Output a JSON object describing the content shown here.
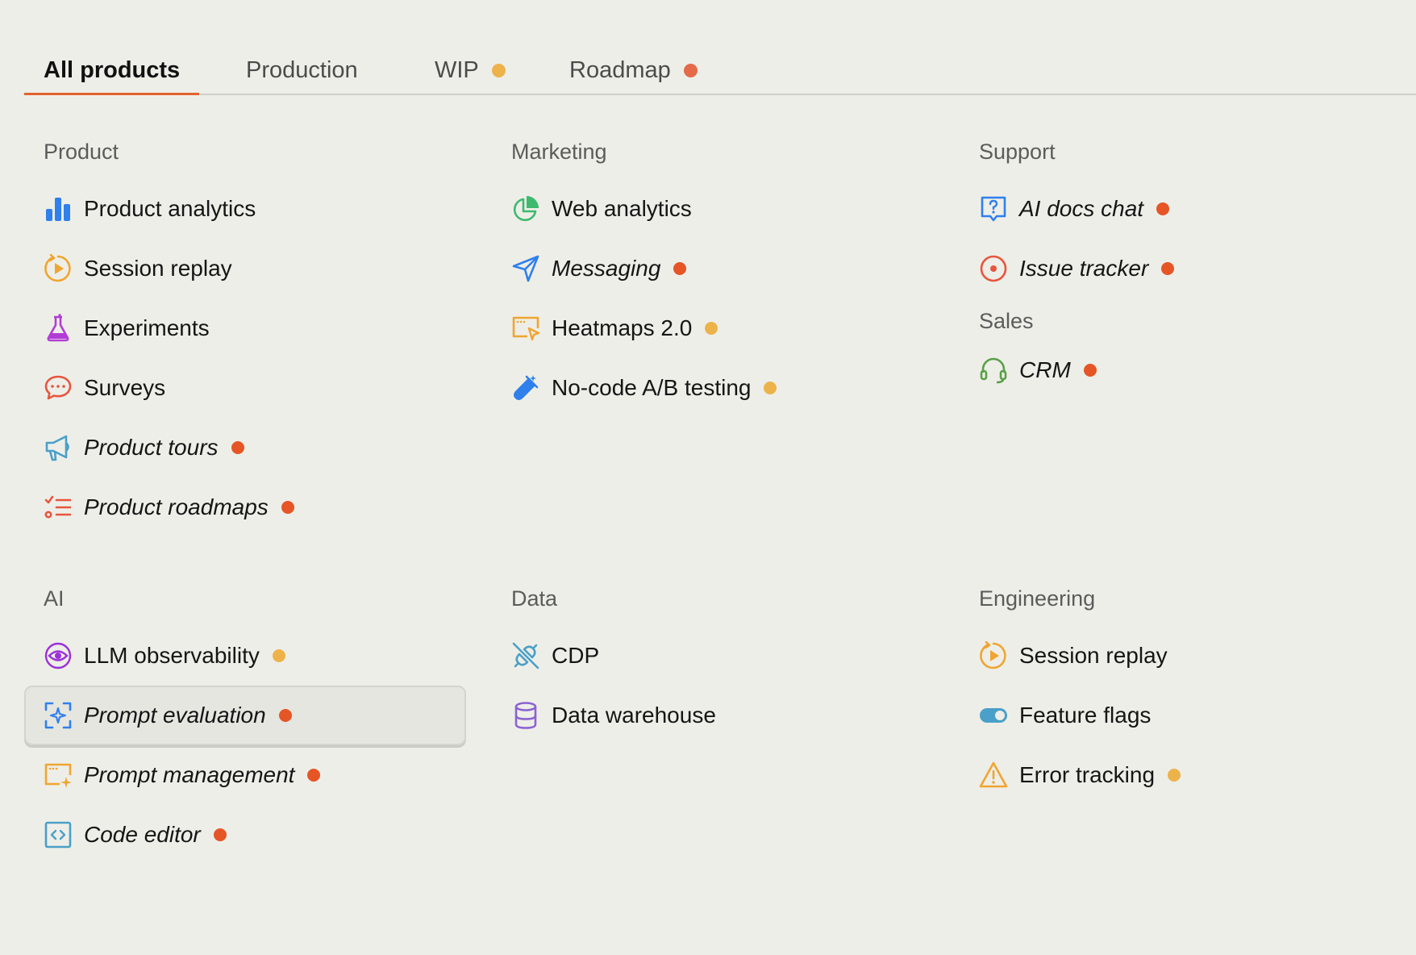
{
  "colors": {
    "background": "#EEEEE8",
    "accent_underline": "#E2622F",
    "roadmap_dot": "#E65525",
    "wip_dot": "#EDB34A"
  },
  "tabs": [
    {
      "label": "All products",
      "active": true
    },
    {
      "label": "Production"
    },
    {
      "label": "WIP",
      "dot": "wip"
    },
    {
      "label": "Roadmap",
      "dot": "roadmap"
    }
  ],
  "sections": [
    {
      "title": "Product",
      "items": [
        {
          "label": "Product analytics",
          "icon": "bar-chart-icon"
        },
        {
          "label": "Session replay",
          "icon": "replay-icon"
        },
        {
          "label": "Experiments",
          "icon": "flask-icon"
        },
        {
          "label": "Surveys",
          "icon": "chat-bubble-icon"
        },
        {
          "label": "Product tours",
          "icon": "megaphone-icon",
          "status": "roadmap",
          "italic": true
        },
        {
          "label": "Product roadmaps",
          "icon": "checklist-icon",
          "status": "roadmap",
          "italic": true
        }
      ]
    },
    {
      "title": "Marketing",
      "items": [
        {
          "label": "Web analytics",
          "icon": "pie-chart-icon"
        },
        {
          "label": "Messaging",
          "icon": "send-icon",
          "status": "roadmap",
          "italic": true
        },
        {
          "label": "Heatmaps 2.0",
          "icon": "heatmap-icon",
          "status": "wip"
        },
        {
          "label": "No-code A/B testing",
          "icon": "test-tube-icon",
          "status": "wip"
        }
      ]
    },
    {
      "title": "Support",
      "items": [
        {
          "label": "AI docs chat",
          "icon": "question-chat-icon",
          "status": "roadmap",
          "italic": true
        },
        {
          "label": "Issue tracker",
          "icon": "target-icon",
          "status": "roadmap",
          "italic": true
        }
      ]
    },
    {
      "title": "Sales",
      "items": [
        {
          "label": "CRM",
          "icon": "headset-icon",
          "status": "roadmap",
          "italic": true
        }
      ]
    },
    {
      "title": "AI",
      "items": [
        {
          "label": "LLM observability",
          "icon": "eye-icon",
          "status": "wip"
        },
        {
          "label": "Prompt evaluation",
          "icon": "sparkle-scan-icon",
          "status": "roadmap",
          "italic": true,
          "selected": true
        },
        {
          "label": "Prompt management",
          "icon": "window-sparkle-icon",
          "status": "roadmap",
          "italic": true
        },
        {
          "label": "Code editor",
          "icon": "code-icon",
          "status": "roadmap",
          "italic": true
        }
      ]
    },
    {
      "title": "Data",
      "items": [
        {
          "label": "CDP",
          "icon": "plug-icon"
        },
        {
          "label": "Data warehouse",
          "icon": "database-icon"
        }
      ]
    },
    {
      "title": "Engineering",
      "items": [
        {
          "label": "Session replay",
          "icon": "replay-icon"
        },
        {
          "label": "Feature flags",
          "icon": "toggle-icon"
        },
        {
          "label": "Error tracking",
          "icon": "warning-icon",
          "status": "wip"
        }
      ]
    }
  ]
}
